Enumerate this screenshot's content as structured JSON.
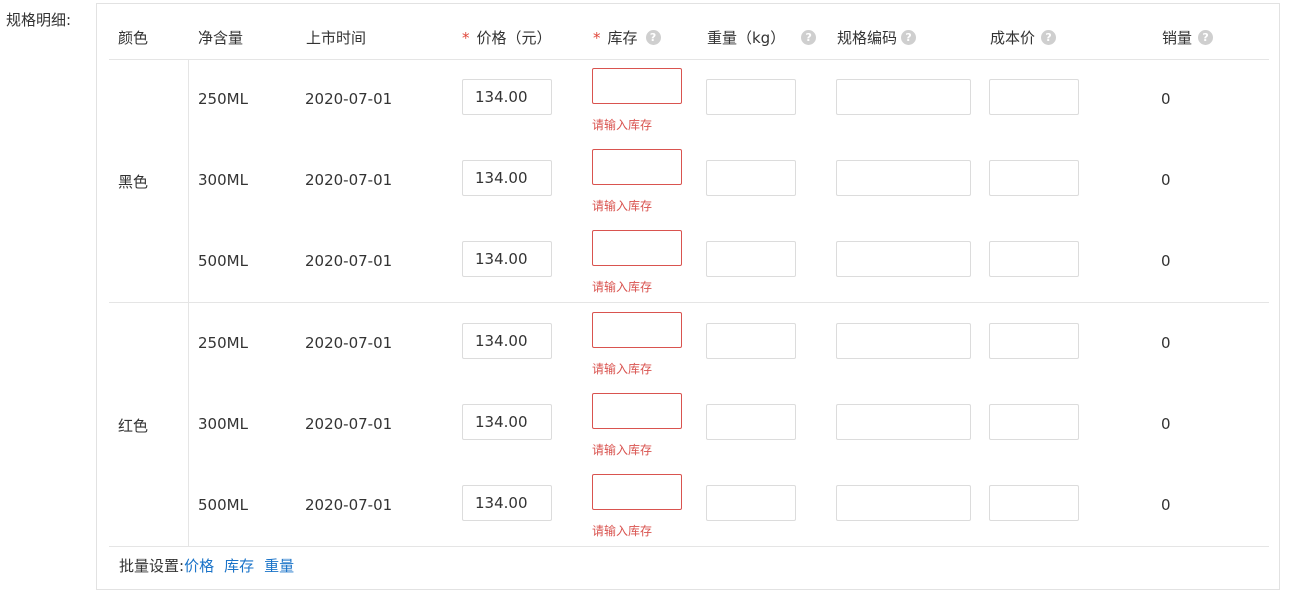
{
  "field_label": "规格明细:",
  "headers": {
    "color": "颜色",
    "volume": "净含量",
    "date": "上市时间",
    "price": "价格（元）",
    "stock": "库存",
    "weight": "重量（kg）",
    "code": "规格编码",
    "cost": "成本价",
    "sales": "销量",
    "required_mark": "*",
    "help_glyph": "?"
  },
  "groups": [
    {
      "color": "黑色",
      "rows": [
        {
          "volume": "250ML",
          "date": "2020-07-01",
          "price": "134.00",
          "stock": "",
          "stock_error": "请输入库存",
          "weight": "",
          "code": "",
          "cost": "",
          "sales": "0"
        },
        {
          "volume": "300ML",
          "date": "2020-07-01",
          "price": "134.00",
          "stock": "",
          "stock_error": "请输入库存",
          "weight": "",
          "code": "",
          "cost": "",
          "sales": "0"
        },
        {
          "volume": "500ML",
          "date": "2020-07-01",
          "price": "134.00",
          "stock": "",
          "stock_error": "请输入库存",
          "weight": "",
          "code": "",
          "cost": "",
          "sales": "0"
        }
      ]
    },
    {
      "color": "红色",
      "rows": [
        {
          "volume": "250ML",
          "date": "2020-07-01",
          "price": "134.00",
          "stock": "",
          "stock_error": "请输入库存",
          "weight": "",
          "code": "",
          "cost": "",
          "sales": "0"
        },
        {
          "volume": "300ML",
          "date": "2020-07-01",
          "price": "134.00",
          "stock": "",
          "stock_error": "请输入库存",
          "weight": "",
          "code": "",
          "cost": "",
          "sales": "0"
        },
        {
          "volume": "500ML",
          "date": "2020-07-01",
          "price": "134.00",
          "stock": "",
          "stock_error": "请输入库存",
          "weight": "",
          "code": "",
          "cost": "",
          "sales": "0"
        }
      ]
    }
  ],
  "footer": {
    "label": "批量设置:",
    "links": [
      "价格",
      "库存",
      "重量"
    ]
  },
  "colors": {
    "error": "#d9534f",
    "required": "#e0473a",
    "link": "#1a73c8",
    "border": "#e5e5e5",
    "help_icon": "#cfcfcf"
  },
  "icons": {
    "help": "question-circle-icon"
  }
}
